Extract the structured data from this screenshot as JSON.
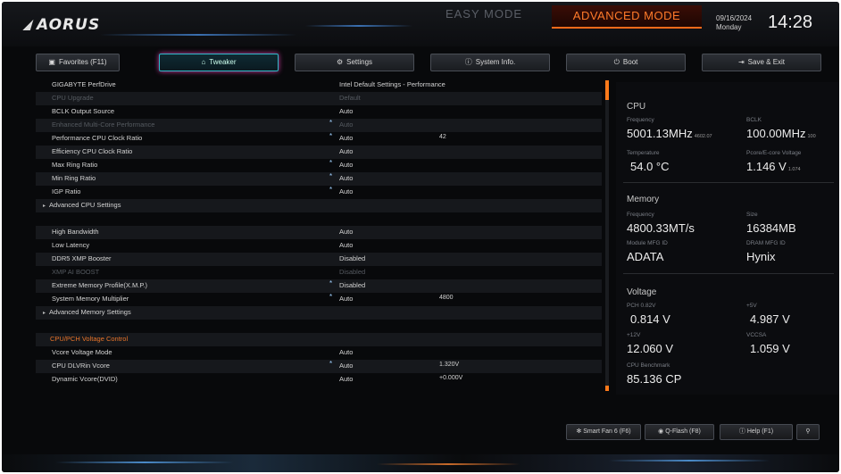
{
  "header": {
    "brand": "AORUS",
    "easy_mode": "EASY MODE",
    "advanced_mode": "ADVANCED MODE",
    "date": "09/16/2024",
    "day": "Monday",
    "time": "14:28"
  },
  "tabs": [
    {
      "label": "Favorites (F11)",
      "icon": "favorites-icon"
    },
    {
      "label": "Tweaker",
      "icon": "tweaker-icon"
    },
    {
      "label": "Settings",
      "icon": "gear-icon"
    },
    {
      "label": "System Info.",
      "icon": "info-icon"
    },
    {
      "label": "Boot",
      "icon": "power-icon"
    },
    {
      "label": "Save & Exit",
      "icon": "exit-icon"
    }
  ],
  "settings": [
    {
      "label": "GIGABYTE PerfDrive",
      "value": "Intel Default Settings - Performance",
      "star": false,
      "dim": false
    },
    {
      "label": "CPU Upgrade",
      "value": "Default",
      "star": false,
      "dim": true
    },
    {
      "label": "BCLK Output Source",
      "value": "Auto",
      "star": false,
      "dim": false
    },
    {
      "label": "Enhanced Multi-Core Performance",
      "value": "Auto",
      "star": true,
      "dim": true
    },
    {
      "label": "Performance CPU Clock Ratio",
      "value": "Auto",
      "value2": "42",
      "star": true,
      "dim": false
    },
    {
      "label": "Efficiency CPU Clock Ratio",
      "value": "Auto",
      "star": false,
      "dim": false
    },
    {
      "label": "Max Ring Ratio",
      "value": "Auto",
      "star": true,
      "dim": false
    },
    {
      "label": "Min Ring Ratio",
      "value": "Auto",
      "star": true,
      "dim": false
    },
    {
      "label": "IGP Ratio",
      "value": "Auto",
      "star": true,
      "dim": false
    },
    {
      "label": "Advanced CPU Settings",
      "submenu": true
    },
    {
      "label": ""
    },
    {
      "label": "High Bandwidth",
      "value": "Auto",
      "star": false,
      "dim": false
    },
    {
      "label": "Low Latency",
      "value": "Auto",
      "star": false,
      "dim": false
    },
    {
      "label": "DDR5 XMP Booster",
      "value": "Disabled",
      "star": false,
      "dim": false
    },
    {
      "label": "XMP AI BOOST",
      "value": "Disabled",
      "star": false,
      "dim": true
    },
    {
      "label": "Extreme Memory Profile(X.M.P.)",
      "value": "Disabled",
      "star": true,
      "dim": false
    },
    {
      "label": "System Memory Multiplier",
      "value": "Auto",
      "value2": "4800",
      "star": true,
      "dim": false
    },
    {
      "label": "Advanced Memory Settings",
      "submenu": true
    },
    {
      "label": ""
    },
    {
      "label": "CPU/PCH Voltage Control",
      "section": true
    },
    {
      "label": "Vcore Voltage Mode",
      "value": "Auto",
      "star": false,
      "dim": false
    },
    {
      "label": "CPU DLVRin Vcore",
      "value": "Auto",
      "value2": "1.320V",
      "star": true,
      "dim": false
    },
    {
      "label": "Dynamic Vcore(DVID)",
      "value": "Auto",
      "value2": "+0.000V",
      "star": false,
      "dim": false
    }
  ],
  "panel": {
    "cpu": {
      "title": "CPU",
      "frequency_label": "Frequency",
      "frequency": "5001.13MHz",
      "frequency_sub": "4602.07",
      "bclk_label": "BCLK",
      "bclk": "100.00MHz",
      "bclk_sub": "100",
      "temperature_label": "Temperature",
      "temperature": "54.0 °C",
      "pcore_label": "Pcore/E-core Voltage",
      "pcore": "1.146 V",
      "pcore_sub": "1.074"
    },
    "memory": {
      "title": "Memory",
      "frequency_label": "Frequency",
      "frequency": "4800.33MT/s",
      "size_label": "Size",
      "size": "16384MB",
      "module_label": "Module MFG ID",
      "module": "ADATA",
      "dram_label": "DRAM MFG ID",
      "dram": "Hynix"
    },
    "voltage": {
      "title": "Voltage",
      "pch_label": "PCH 0.82V",
      "pch": "0.814 V",
      "v5_label": "+5V",
      "v5": "4.987 V",
      "v12_label": "+12V",
      "v12": "12.060 V",
      "vccsa_label": "VCCSA",
      "vccsa": "1.059 V",
      "cpu_bench_label": "CPU Benchmark",
      "cpu_bench": "85.136 CP"
    }
  },
  "bottom": {
    "smart_fan": "Smart Fan 6 (F6)",
    "qflash": "Q-Flash (F8)",
    "help": "Help (F1)",
    "search_icon": "search-icon"
  }
}
